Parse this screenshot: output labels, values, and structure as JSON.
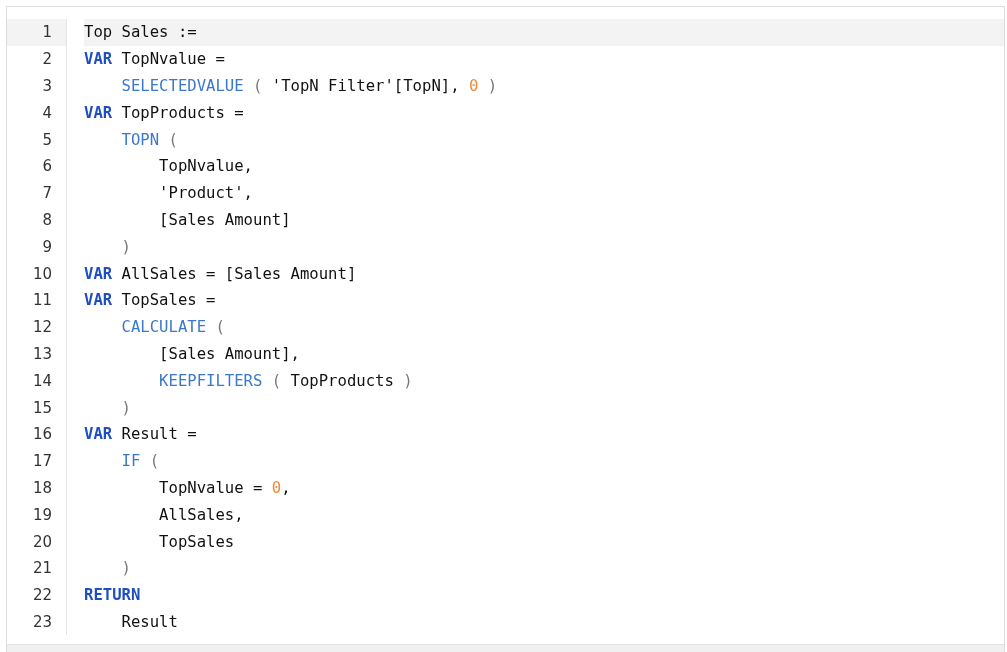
{
  "editor": {
    "lines": [
      {
        "number": "1",
        "highlighted": true,
        "tokens": [
          {
            "kind": "text",
            "text": "Top Sales :="
          }
        ]
      },
      {
        "number": "2",
        "highlighted": false,
        "tokens": [
          {
            "kind": "keyword",
            "text": "VAR"
          },
          {
            "kind": "text",
            "text": " TopNvalue ="
          }
        ]
      },
      {
        "number": "3",
        "highlighted": false,
        "tokens": [
          {
            "kind": "function",
            "text": "    SELECTEDVALUE"
          },
          {
            "kind": "punct",
            "text": " ( "
          },
          {
            "kind": "text",
            "text": "'TopN Filter'[TopN], "
          },
          {
            "kind": "number",
            "text": "0"
          },
          {
            "kind": "punct",
            "text": " )"
          }
        ]
      },
      {
        "number": "4",
        "highlighted": false,
        "tokens": [
          {
            "kind": "keyword",
            "text": "VAR"
          },
          {
            "kind": "text",
            "text": " TopProducts ="
          }
        ]
      },
      {
        "number": "5",
        "highlighted": false,
        "tokens": [
          {
            "kind": "function",
            "text": "    TOPN"
          },
          {
            "kind": "punct",
            "text": " ("
          }
        ]
      },
      {
        "number": "6",
        "highlighted": false,
        "tokens": [
          {
            "kind": "text",
            "text": "        TopNvalue,"
          }
        ]
      },
      {
        "number": "7",
        "highlighted": false,
        "tokens": [
          {
            "kind": "text",
            "text": "        'Product',"
          }
        ]
      },
      {
        "number": "8",
        "highlighted": false,
        "tokens": [
          {
            "kind": "text",
            "text": "        [Sales Amount]"
          }
        ]
      },
      {
        "number": "9",
        "highlighted": false,
        "tokens": [
          {
            "kind": "punct",
            "text": "    )"
          }
        ]
      },
      {
        "number": "10",
        "highlighted": false,
        "tokens": [
          {
            "kind": "keyword",
            "text": "VAR"
          },
          {
            "kind": "text",
            "text": " AllSales = [Sales Amount]"
          }
        ]
      },
      {
        "number": "11",
        "highlighted": false,
        "tokens": [
          {
            "kind": "keyword",
            "text": "VAR"
          },
          {
            "kind": "text",
            "text": " TopSales ="
          }
        ]
      },
      {
        "number": "12",
        "highlighted": false,
        "tokens": [
          {
            "kind": "function",
            "text": "    CALCULATE"
          },
          {
            "kind": "punct",
            "text": " ("
          }
        ]
      },
      {
        "number": "13",
        "highlighted": false,
        "tokens": [
          {
            "kind": "text",
            "text": "        [Sales Amount],"
          }
        ]
      },
      {
        "number": "14",
        "highlighted": false,
        "tokens": [
          {
            "kind": "function",
            "text": "        KEEPFILTERS"
          },
          {
            "kind": "punct",
            "text": " ( "
          },
          {
            "kind": "text",
            "text": "TopProducts"
          },
          {
            "kind": "punct",
            "text": " )"
          }
        ]
      },
      {
        "number": "15",
        "highlighted": false,
        "tokens": [
          {
            "kind": "punct",
            "text": "    )"
          }
        ]
      },
      {
        "number": "16",
        "highlighted": false,
        "tokens": [
          {
            "kind": "keyword",
            "text": "VAR"
          },
          {
            "kind": "text",
            "text": " Result ="
          }
        ]
      },
      {
        "number": "17",
        "highlighted": false,
        "tokens": [
          {
            "kind": "function",
            "text": "    IF"
          },
          {
            "kind": "punct",
            "text": " ("
          }
        ]
      },
      {
        "number": "18",
        "highlighted": false,
        "tokens": [
          {
            "kind": "text",
            "text": "        TopNvalue = "
          },
          {
            "kind": "number",
            "text": "0"
          },
          {
            "kind": "text",
            "text": ","
          }
        ]
      },
      {
        "number": "19",
        "highlighted": false,
        "tokens": [
          {
            "kind": "text",
            "text": "        AllSales,"
          }
        ]
      },
      {
        "number": "20",
        "highlighted": false,
        "tokens": [
          {
            "kind": "text",
            "text": "        TopSales"
          }
        ]
      },
      {
        "number": "21",
        "highlighted": false,
        "tokens": [
          {
            "kind": "punct",
            "text": "    )"
          }
        ]
      },
      {
        "number": "22",
        "highlighted": false,
        "tokens": [
          {
            "kind": "keyword",
            "text": "RETURN"
          }
        ]
      },
      {
        "number": "23",
        "highlighted": false,
        "tokens": [
          {
            "kind": "text",
            "text": "    Result"
          }
        ]
      }
    ]
  }
}
